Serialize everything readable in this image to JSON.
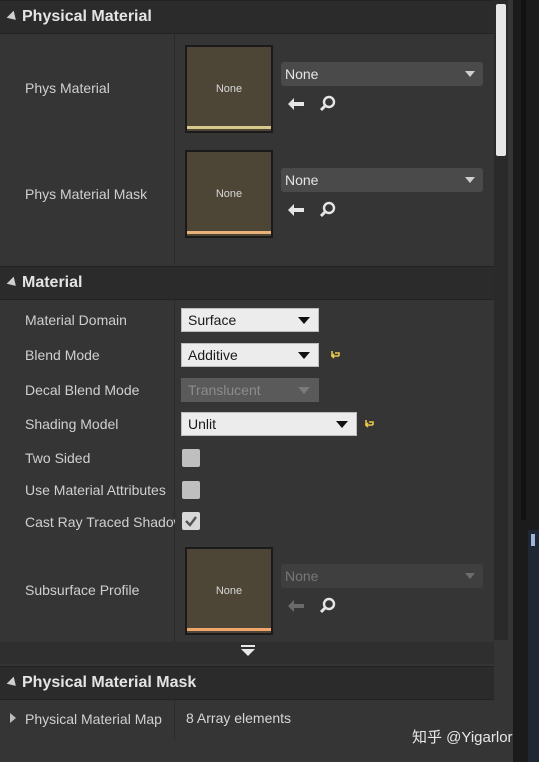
{
  "sections": {
    "physical_material": {
      "title": "Physical Material",
      "phys_material": {
        "label": "Phys Material",
        "thumbnail_text": "None",
        "combo_value": "None",
        "thumb_bar_color": "#d8c98b"
      },
      "phys_material_mask": {
        "label": "Phys Material Mask",
        "thumbnail_text": "None",
        "combo_value": "None",
        "thumb_bar_color": "#e9b27a"
      }
    },
    "material": {
      "title": "Material",
      "material_domain": {
        "label": "Material Domain",
        "value": "Surface"
      },
      "blend_mode": {
        "label": "Blend Mode",
        "value": "Additive"
      },
      "decal_blend_mode": {
        "label": "Decal Blend Mode",
        "value": "Translucent"
      },
      "shading_model": {
        "label": "Shading Model",
        "value": "Unlit"
      },
      "two_sided": {
        "label": "Two Sided",
        "checked": false
      },
      "use_material_attributes": {
        "label": "Use Material Attributes",
        "checked": false
      },
      "cast_ray_traced_shadows": {
        "label": "Cast Ray Traced Shadows",
        "checked": true
      },
      "subsurface_profile": {
        "label": "Subsurface Profile",
        "thumbnail_text": "None",
        "combo_value": "None",
        "thumb_bar_color": "#f0a66a"
      }
    },
    "physical_material_mask": {
      "title": "Physical Material Mask",
      "physical_material_map": {
        "label": "Physical Material Map",
        "value": "8 Array elements"
      }
    }
  },
  "watermark": "知乎 @Yigarlor",
  "colors": {
    "reset_arrow": "#e5c84a",
    "panel_bg": "#353535",
    "header_bg": "#2b2b2b"
  }
}
